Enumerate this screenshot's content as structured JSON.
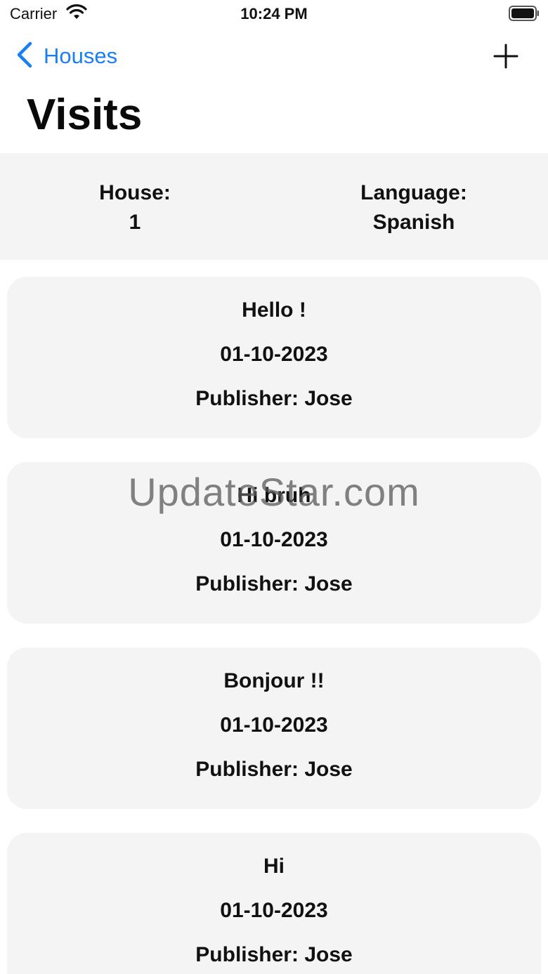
{
  "status_bar": {
    "carrier": "Carrier",
    "time": "10:24 PM",
    "wifi_icon": "wifi-icon",
    "battery_icon": "battery-icon"
  },
  "nav": {
    "back_label": "Houses",
    "back_icon": "chevron-left-icon",
    "add_icon": "plus-icon",
    "title": "Visits",
    "accent_color": "#1a7ff0"
  },
  "info": {
    "house_label": "House:",
    "house_value": "1",
    "language_label": "Language:",
    "language_value": "Spanish"
  },
  "visits": [
    {
      "greeting": "Hello !",
      "date": "01-10-2023",
      "publisher_label": "Publisher:",
      "publisher": "Jose"
    },
    {
      "greeting": "Hi bruh",
      "date": "01-10-2023",
      "publisher_label": "Publisher:",
      "publisher": "Jose"
    },
    {
      "greeting": "Bonjour !!",
      "date": "01-10-2023",
      "publisher_label": "Publisher:",
      "publisher": "Jose"
    },
    {
      "greeting": "Hi",
      "date": "01-10-2023",
      "publisher_label": "Publisher:",
      "publisher": "Jose"
    }
  ],
  "watermark": "UpdateStar.com"
}
